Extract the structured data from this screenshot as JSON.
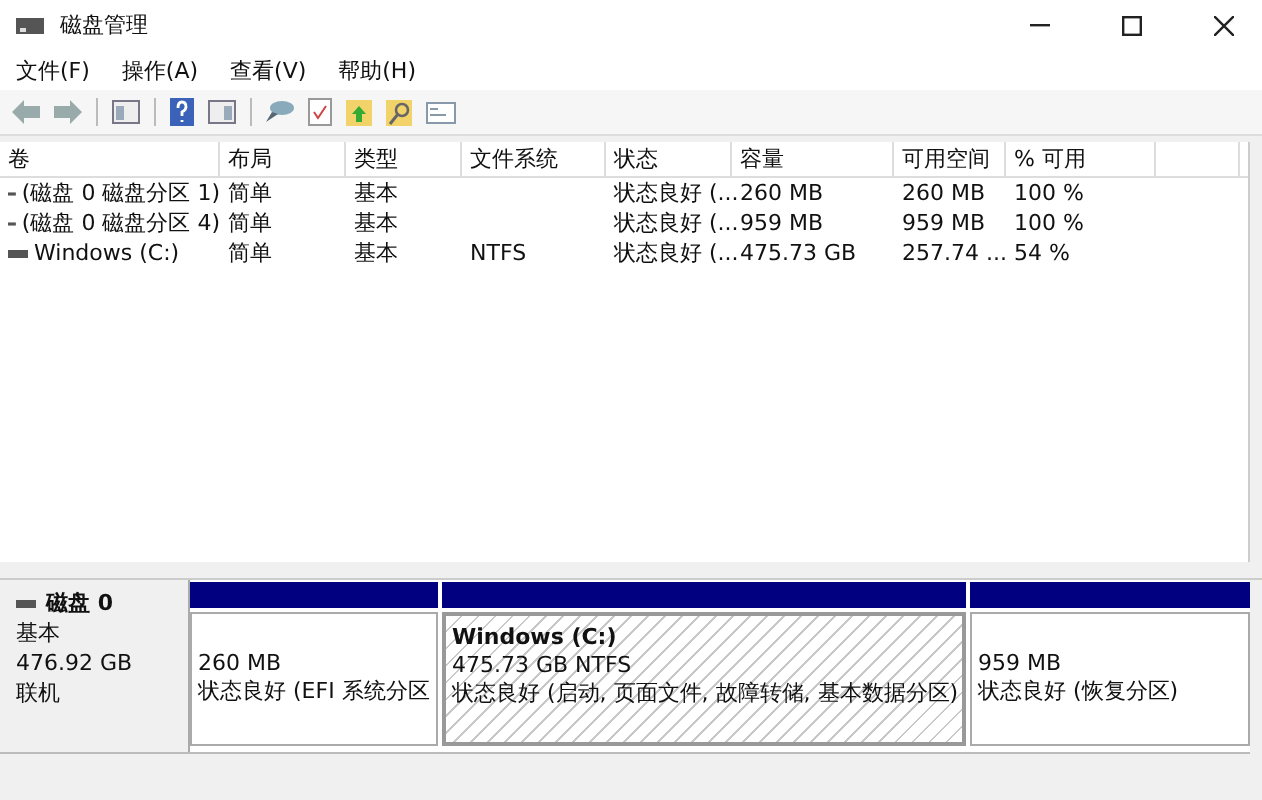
{
  "window": {
    "title": "磁盘管理"
  },
  "menu": [
    "文件(F)",
    "操作(A)",
    "查看(V)",
    "帮助(H)"
  ],
  "table": {
    "columns": [
      "卷",
      "布局",
      "类型",
      "文件系统",
      "状态",
      "容量",
      "可用空间",
      "% 可用"
    ],
    "rows": [
      [
        "(磁盘 0 磁盘分区 1)",
        "简单",
        "基本",
        "",
        "状态良好 (...",
        "260 MB",
        "260 MB",
        "100 %"
      ],
      [
        "(磁盘 0 磁盘分区 4)",
        "简单",
        "基本",
        "",
        "状态良好 (...",
        "959 MB",
        "959 MB",
        "100 %"
      ],
      [
        "Windows (C:)",
        "简单",
        "基本",
        "NTFS",
        "状态良好 (...",
        "475.73 GB",
        "257.74 ...",
        "54 %"
      ]
    ]
  },
  "disk": {
    "name": "磁盘 0",
    "type": "基本",
    "size": "476.92 GB",
    "status": "联机",
    "partitions": [
      {
        "size": "260 MB",
        "status": "状态良好 (EFI 系统分区",
        "selected": false
      },
      {
        "title": "Windows  (C:)",
        "size": "475.73 GB NTFS",
        "status": "状态良好 (启动, 页面文件, 故障转储, 基本数据分区)",
        "selected": true
      },
      {
        "size": "959 MB",
        "status": "状态良好 (恢复分区)",
        "selected": false
      }
    ]
  }
}
